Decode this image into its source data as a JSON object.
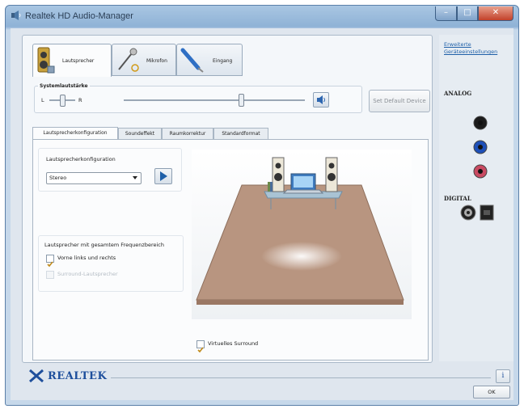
{
  "window": {
    "title": "Realtek HD Audio-Manager",
    "buttons": {
      "minimize": "–",
      "maximize": "□",
      "close": "✕"
    }
  },
  "device_tabs": [
    {
      "label": "Lautsprecher",
      "active": true
    },
    {
      "label": "Mikrofon",
      "active": false
    },
    {
      "label": "Eingang",
      "active": false
    }
  ],
  "volume": {
    "group_label": "Systemlautstärke",
    "left_label": "L",
    "right_label": "R",
    "balance_position": 0.5,
    "volume_level": 0.7
  },
  "set_default_button": "Set Default Device",
  "sub_tabs": [
    {
      "label": "Lautsprecherkonfiguration",
      "active": true
    },
    {
      "label": "Soundeffekt",
      "active": false
    },
    {
      "label": "Raumkorrektur",
      "active": false
    },
    {
      "label": "Standardformat",
      "active": false
    }
  ],
  "speaker_config": {
    "group_label": "Lautsprecherkonfiguration",
    "selected": "Stereo",
    "fullrange_label": "Lautsprecher mit gesamtem Frequenzbereich",
    "front_label": "Vorne links und rechts",
    "front_checked": true,
    "surround_label": "Surround-Lautsprecher",
    "surround_checked": false,
    "virtual_surround_label": "Virtuelles Surround",
    "virtual_surround_checked": true
  },
  "right_panel": {
    "advanced_link": "Erweiterte Geräteeinstellungen",
    "analog_label": "ANALOG",
    "digital_label": "DIGITAL",
    "jack_colors": [
      "#1b1b1b",
      "#1d4fb8",
      "#c94a62"
    ]
  },
  "footer": {
    "brand": "REALTEK",
    "ok_button": "OK",
    "info_icon": "i"
  },
  "colors": {
    "accent": "#1e5fa8",
    "floor": "#b89580"
  }
}
